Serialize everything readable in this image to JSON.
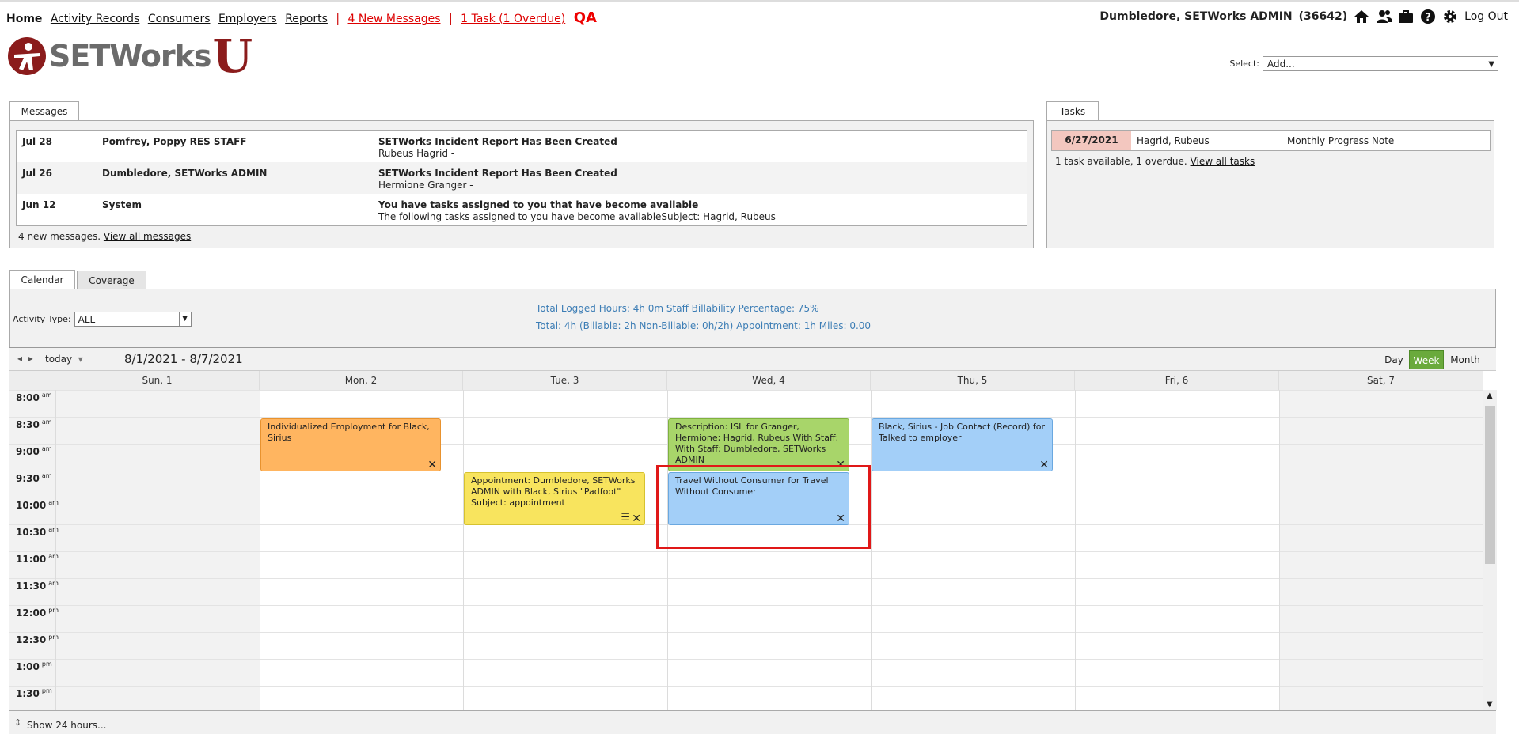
{
  "nav": {
    "home": "Home",
    "links": [
      "Activity Records",
      "Consumers",
      "Employers",
      "Reports"
    ],
    "separator": "|",
    "messages": "4 New Messages",
    "tasks": "1 Task (1 Overdue)",
    "qa": "QA",
    "user": "Dumbledore, SETWorks ADMIN",
    "user_id": "(36642)",
    "logout": "Log Out"
  },
  "logo": {
    "word": "SETWorks",
    "letter": "U"
  },
  "select": {
    "label": "Select:",
    "value": "Add..."
  },
  "messages_panel": {
    "tab": "Messages",
    "rows": [
      {
        "date": "Jul 28",
        "from": "Pomfrey, Poppy RES STAFF",
        "subject": "SETWorks Incident Report Has Been Created",
        "body": "Rubeus Hagrid -"
      },
      {
        "date": "Jul 26",
        "from": "Dumbledore, SETWorks ADMIN",
        "subject": "SETWorks Incident Report Has Been Created",
        "body": "Hermione Granger -"
      },
      {
        "date": "Jun 12",
        "from": "System",
        "subject": "You have tasks assigned to you that have become available",
        "body": "The following tasks assigned to you have become availableSubject: Hagrid, Rubeus"
      }
    ],
    "footer": "4 new messages.",
    "footer_link": "View all messages"
  },
  "tasks_panel": {
    "tab": "Tasks",
    "row": {
      "date": "6/27/2021",
      "name": "Hagrid, Rubeus",
      "task": "Monthly Progress Note"
    },
    "footer": "1 task available, 1 overdue.",
    "footer_link": "View all tasks"
  },
  "calendar_tabs": {
    "calendar": "Calendar",
    "coverage": "Coverage"
  },
  "filter": {
    "label": "Activity Type:",
    "value": "ALL"
  },
  "summary": {
    "line1": "Total Logged Hours: 4h 0m   Staff Billability Percentage: 75%",
    "line2": "Total: 4h   (Billable: 2h   Non-Billable: 0h/2h)   Appointment: 1h   Miles: 0.00"
  },
  "toolbar": {
    "prev": "◂",
    "next": "▸",
    "today": "today",
    "today_caret": "▾",
    "range": "8/1/2021 - 8/7/2021",
    "views": [
      "Day",
      "Week",
      "Month"
    ]
  },
  "days": [
    "Sun, 1",
    "Mon, 2",
    "Tue, 3",
    "Wed, 4",
    "Thu, 5",
    "Fri, 6",
    "Sat, 7"
  ],
  "times": [
    {
      "t": "8:00",
      "p": "am"
    },
    {
      "t": "8:30",
      "p": "am"
    },
    {
      "t": "9:00",
      "p": "am"
    },
    {
      "t": "9:30",
      "p": "am"
    },
    {
      "t": "10:00",
      "p": "am"
    },
    {
      "t": "10:30",
      "p": "am"
    },
    {
      "t": "11:00",
      "p": "am"
    },
    {
      "t": "11:30",
      "p": "am"
    },
    {
      "t": "12:00",
      "p": "pm"
    },
    {
      "t": "12:30",
      "p": "pm"
    },
    {
      "t": "1:00",
      "p": "pm"
    },
    {
      "t": "1:30",
      "p": "pm"
    }
  ],
  "events": [
    {
      "text": "Individualized Employment for Black, Sirius",
      "color": "#ffb560",
      "border": "#e8922e"
    },
    {
      "text": "Appointment: Dumbledore, SETWorks ADMIN with Black, Sirius \"Padfoot\" Subject: appointment",
      "color": "#f8e45e",
      "border": "#d6c230"
    },
    {
      "text": "Description: ISL for Granger, Hermione; Hagrid, Rubeus With Staff: With Staff: Dumbledore, SETWorks ADMIN",
      "color": "#a8d56a",
      "border": "#7fb13e"
    },
    {
      "text": "Travel Without Consumer for Travel Without Consumer",
      "color": "#a3cff8",
      "border": "#6aa8e0"
    },
    {
      "text": "Black, Sirius - Job Contact (Record) for Talked to employer",
      "color": "#a3cff8",
      "border": "#6aa8e0"
    }
  ],
  "footer": {
    "show24": "Show 24 hours..."
  }
}
